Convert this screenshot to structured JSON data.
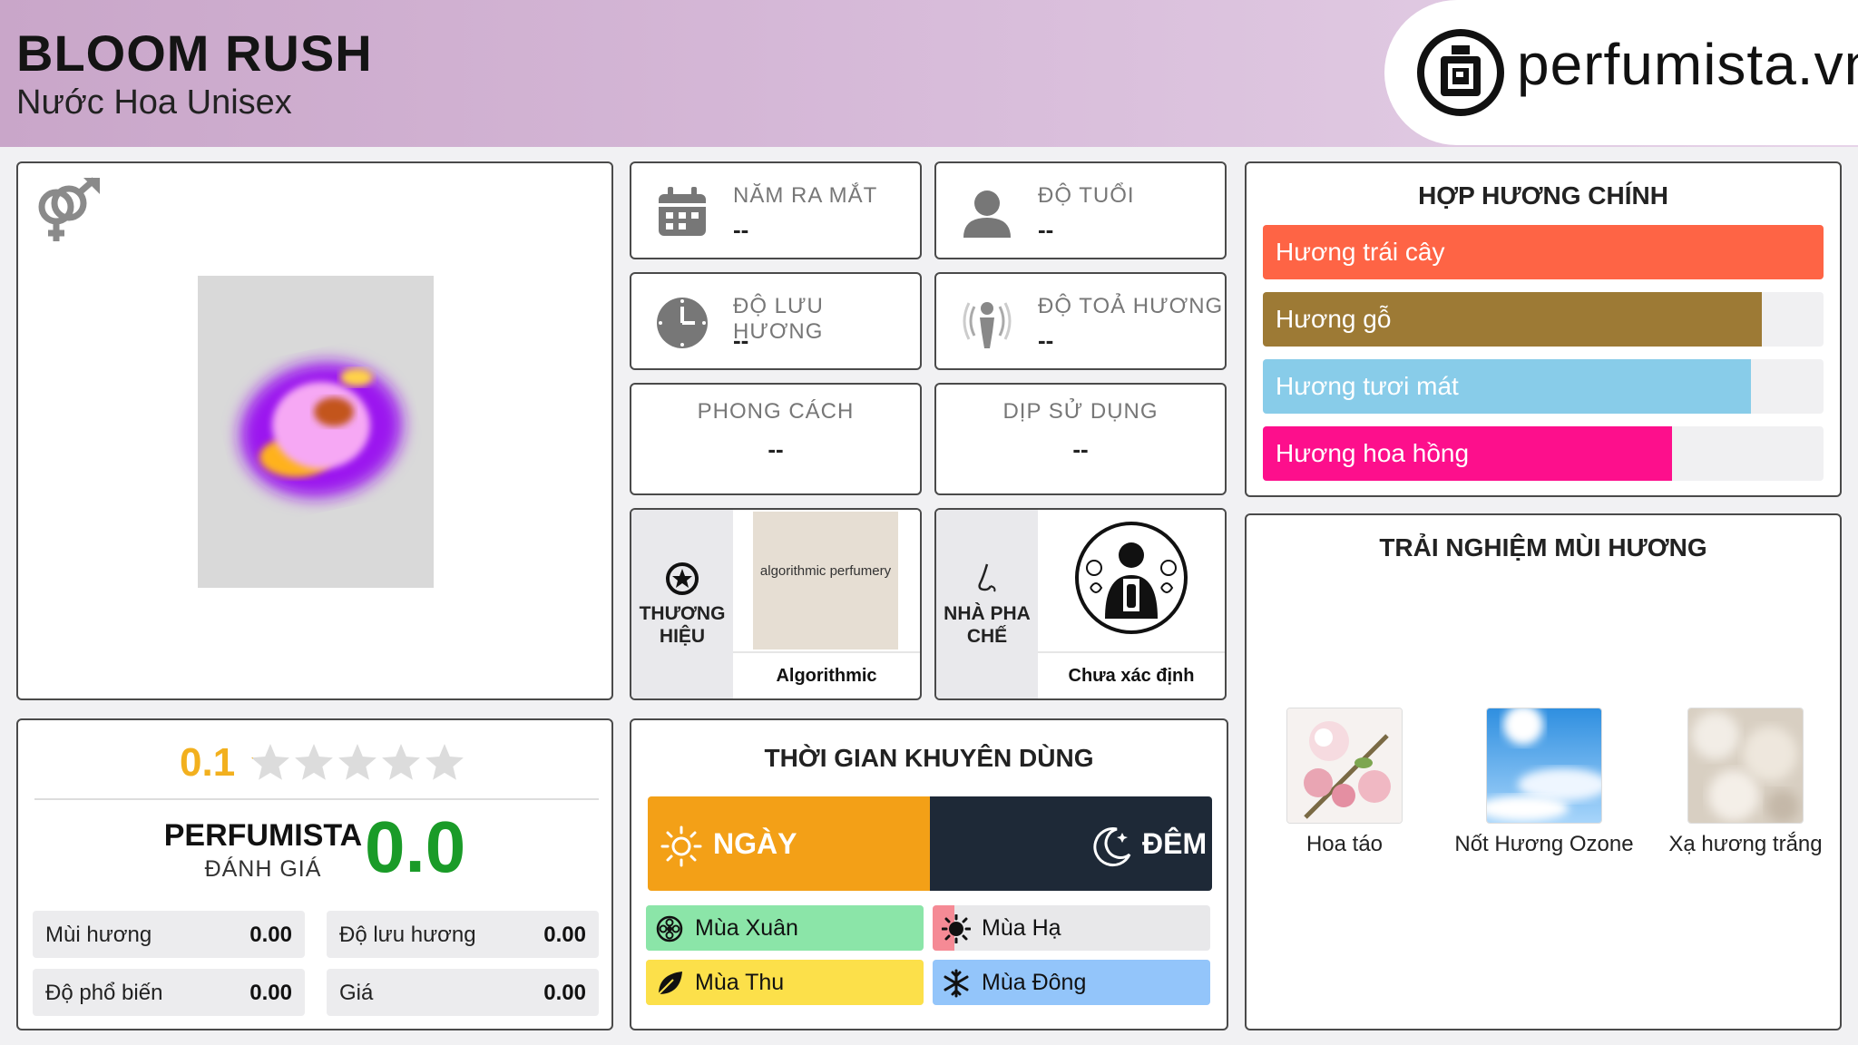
{
  "header": {
    "title": "BLOOM RUSH",
    "subtitle": "Nước Hoa Unisex",
    "brand": "perfumista.vn"
  },
  "colors": {
    "accent_orange": "#f3a017",
    "night_dark": "#1e2937",
    "score_green": "#1a9b28",
    "score_gold": "#f2b01e"
  },
  "product": {
    "gender_icon": "male-female-icon"
  },
  "info": {
    "launch_year": {
      "label": "NĂM RA MẮT",
      "value": "--"
    },
    "age": {
      "label": "ĐỘ TUỔI",
      "value": "--"
    },
    "longevity": {
      "label": "ĐỘ LƯU HƯƠNG",
      "value": "--"
    },
    "sillage": {
      "label": "ĐỘ TOẢ HƯƠNG",
      "value": "--"
    },
    "style": {
      "label": "PHONG CÁCH",
      "value": "--"
    },
    "occasion": {
      "label": "DỊP SỬ DỤNG",
      "value": "--"
    }
  },
  "brand_card": {
    "label": "THƯƠNG HIỆU",
    "logo_text": "algorithmic perfumery",
    "name": "Algorithmic Perfumery"
  },
  "perfumer_card": {
    "label": "NHÀ PHA CHẾ",
    "name": "Chưa xác định"
  },
  "accords": {
    "title": "HỢP HƯƠNG CHÍNH",
    "items": [
      {
        "label": "Hương trái cây",
        "percent": 100,
        "color": "#fe6445"
      },
      {
        "label": "Hương gỗ",
        "percent": 89,
        "color": "#9d7a35"
      },
      {
        "label": "Hương tươi mát",
        "percent": 87,
        "color": "#88cce9"
      },
      {
        "label": "Hương hoa hồng",
        "percent": 73,
        "color": "#fd0f8c"
      }
    ]
  },
  "experience": {
    "title": "TRẢI NGHIỆM MÙI HƯƠNG",
    "notes": [
      {
        "name": "Hoa táo"
      },
      {
        "name": "Nốt Hương Ozone"
      },
      {
        "name": "Xạ hương trắng"
      }
    ]
  },
  "rating": {
    "community_score": "0.1",
    "stars_value": 0.1,
    "stars_max": 5,
    "perfumista_label": "PERFUMISTA",
    "perfumista_sub": "ĐÁNH GIÁ",
    "perfumista_score": "0.0",
    "metrics": [
      {
        "name": "Mùi hương",
        "value": "0.00"
      },
      {
        "name": "Độ lưu hương",
        "value": "0.00"
      },
      {
        "name": "Độ phổ biến",
        "value": "0.00"
      },
      {
        "name": "Giá",
        "value": "0.00"
      }
    ]
  },
  "time": {
    "title": "THỜI GIAN KHUYÊN DÙNG",
    "day_label": "NGÀY",
    "night_label": "ĐÊM",
    "day_share": 50,
    "seasons": [
      {
        "label": "Mùa Xuân",
        "fill": 100,
        "color": "#8be5a8",
        "icon": "flower-icon"
      },
      {
        "label": "Mùa Hạ",
        "fill": 8,
        "color": "#f58a95",
        "icon": "sun-icon"
      },
      {
        "label": "Mùa Thu",
        "fill": 100,
        "color": "#fce04a",
        "icon": "leaf-icon"
      },
      {
        "label": "Mùa Đông",
        "fill": 100,
        "color": "#93c5fa",
        "icon": "snowflake-icon"
      }
    ]
  }
}
